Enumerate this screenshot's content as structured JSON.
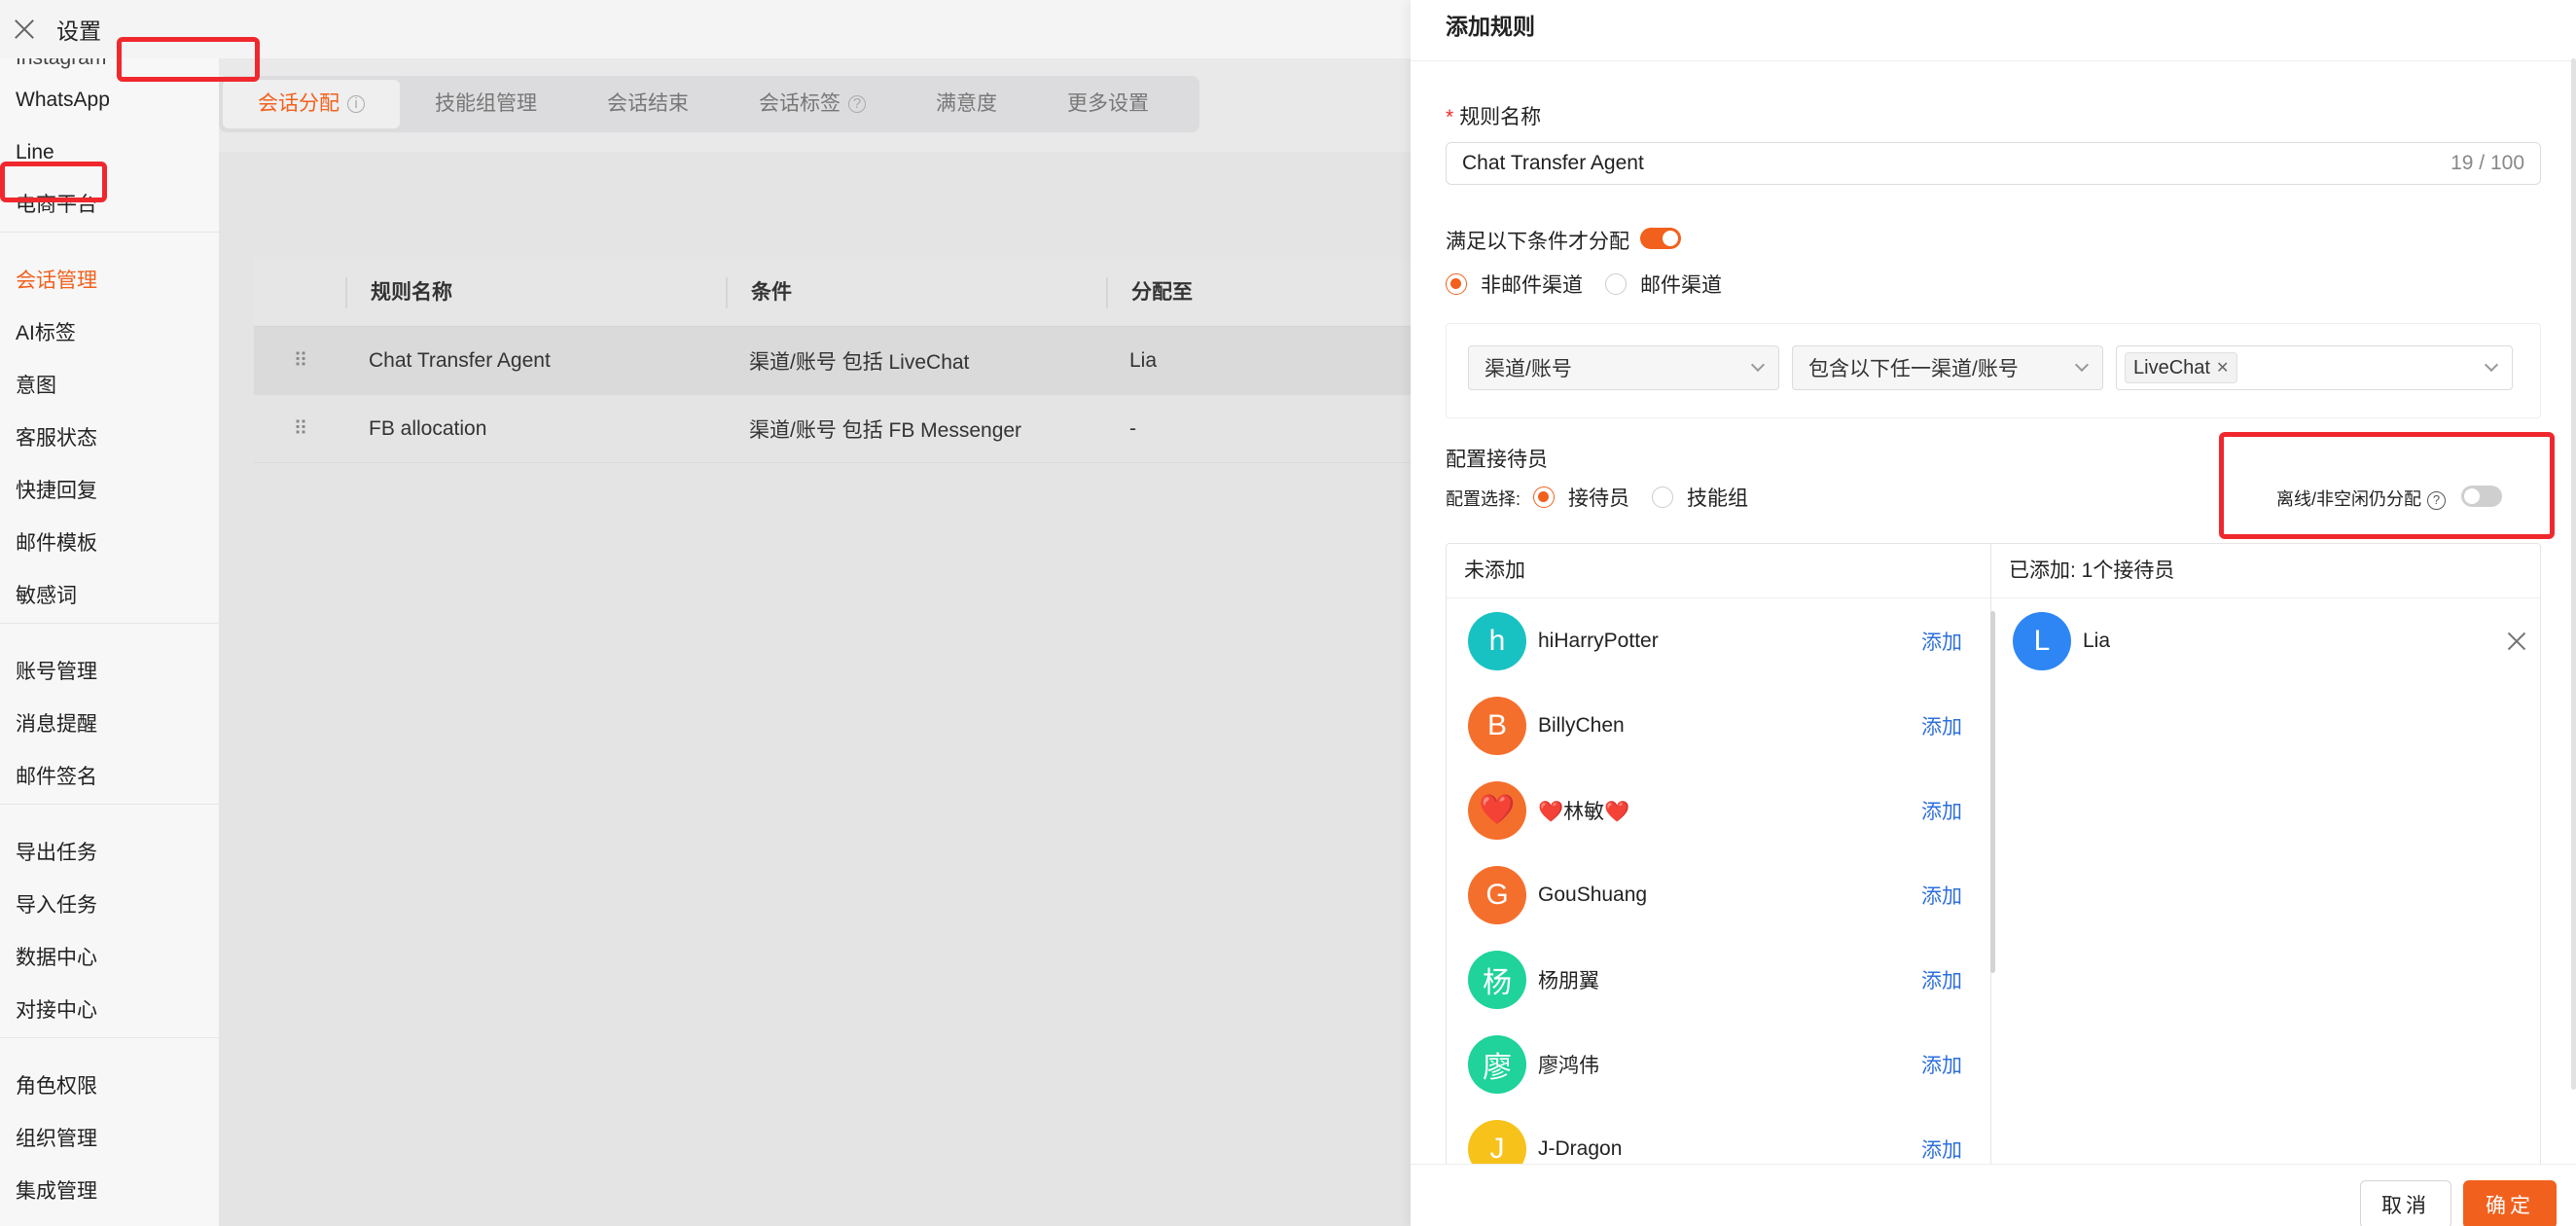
{
  "window": {
    "title": "设置"
  },
  "sidebar": {
    "items": [
      {
        "label": "Instagram",
        "cut": true
      },
      {
        "label": "WhatsApp"
      },
      {
        "label": "Line"
      },
      {
        "label": "电商平台"
      },
      {
        "gap": true
      },
      {
        "label": "会话管理",
        "active": true
      },
      {
        "label": "AI标签"
      },
      {
        "label": "意图"
      },
      {
        "label": "客服状态"
      },
      {
        "label": "快捷回复"
      },
      {
        "label": "邮件模板"
      },
      {
        "label": "敏感词"
      },
      {
        "gap": true
      },
      {
        "label": "账号管理"
      },
      {
        "label": "消息提醒"
      },
      {
        "label": "邮件签名"
      },
      {
        "gap": true
      },
      {
        "label": "导出任务"
      },
      {
        "label": "导入任务"
      },
      {
        "label": "数据中心"
      },
      {
        "label": "对接中心"
      },
      {
        "gap": true
      },
      {
        "label": "角色权限"
      },
      {
        "label": "组织管理"
      },
      {
        "label": "集成管理"
      }
    ]
  },
  "tabs": [
    {
      "label": "会话分配",
      "active": true,
      "icon": "info-icon"
    },
    {
      "label": "技能组管理"
    },
    {
      "label": "会话结束"
    },
    {
      "label": "会话标签",
      "icon": "help-icon"
    },
    {
      "label": "满意度"
    },
    {
      "label": "更多设置"
    }
  ],
  "rules_table": {
    "columns": [
      "规则名称",
      "条件",
      "分配至"
    ],
    "rows": [
      {
        "name": "Chat Transfer Agent",
        "condition": "渠道/账号 包括 LiveChat",
        "assignee": "Lia",
        "highlight": true
      },
      {
        "name": "FB allocation",
        "condition": "渠道/账号 包括 FB Messenger",
        "assignee": "-"
      }
    ]
  },
  "drawer": {
    "title": "添加规则",
    "rule_name": {
      "required_mark": "*",
      "label": "规则名称",
      "value": "Chat Transfer Agent",
      "counter": "19 / 100"
    },
    "condition_switch": {
      "label": "满足以下条件才分配",
      "on": true
    },
    "channel_radios": [
      {
        "label": "非邮件渠道",
        "checked": true
      },
      {
        "label": "邮件渠道",
        "checked": false
      }
    ],
    "condition_row": {
      "field": "渠道/账号",
      "operator": "包含以下任一渠道/账号",
      "value_tag": "LiveChat"
    },
    "agents_section": {
      "label": "配置接待员",
      "select_label": "配置选择:",
      "radios": [
        {
          "label": "接待员",
          "checked": true
        },
        {
          "label": "技能组",
          "checked": false
        }
      ],
      "offline_label": "离线/非空闲仍分配",
      "offline_on": false
    },
    "transfer": {
      "left_title": "未添加",
      "right_title": "已添加: 1个接待员",
      "add_label": "添加",
      "available": [
        {
          "initial": "h",
          "name": "hiHarryPotter",
          "color": "#19c2c2"
        },
        {
          "initial": "B",
          "name": "BillyChen",
          "color": "#f56f2c"
        },
        {
          "initial": "❤️",
          "name": "❤️林敏❤️",
          "color": "#f56f2c"
        },
        {
          "initial": "G",
          "name": "GouShuang",
          "color": "#f56f2c"
        },
        {
          "initial": "杨",
          "name": "杨朋翼",
          "color": "#1fd39a"
        },
        {
          "initial": "廖",
          "name": "廖鸿伟",
          "color": "#1fd39a"
        },
        {
          "initial": "J",
          "name": "J-Dragon",
          "color": "#f7c21a"
        }
      ],
      "added": [
        {
          "initial": "L",
          "name": "Lia",
          "color": "#2e86f5"
        }
      ]
    },
    "footer": {
      "cancel": "取消",
      "ok": "确定"
    }
  },
  "colors": {
    "accent": "#f2601d",
    "highlight_box": "#f0282d",
    "link": "#2e6fdc"
  }
}
